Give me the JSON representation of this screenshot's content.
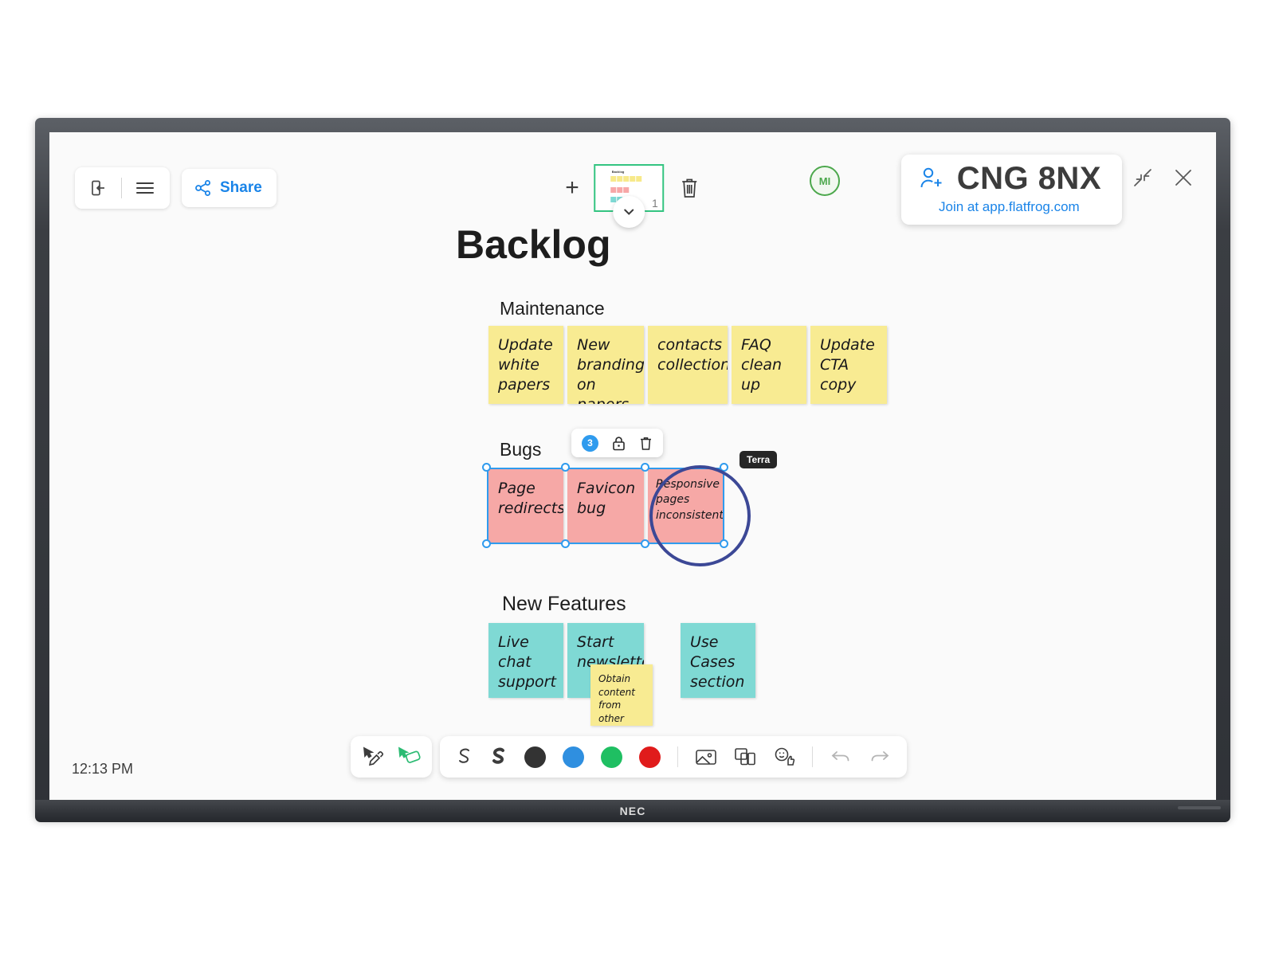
{
  "device": {
    "brand": "NEC"
  },
  "topbar": {
    "exit_icon": "exit-door-icon",
    "menu_icon": "hamburger-menu-icon",
    "share_label": "Share",
    "share_icon": "share-nodes-icon",
    "add_page_label": "+",
    "page_number": "1",
    "delete_page_icon": "trash-icon",
    "expand_pages_icon": "chevron-down-icon",
    "avatar_initials": "MI",
    "session_code": "CNG 8NX",
    "join_text": "Join at app.flatfrog.com",
    "invite_icon": "add-person-icon",
    "minimize_icon": "collapse-arrows-icon",
    "close_icon": "close-icon"
  },
  "board": {
    "title": "Backlog",
    "sections": [
      {
        "label": "Maintenance",
        "notes": [
          "Update white papers",
          "New branding on papers",
          "contacts collection",
          "FAQ clean up",
          "Update CTA copy"
        ]
      },
      {
        "label": "Bugs",
        "notes": [
          "Page redirects",
          "Favicon bug",
          "Responsive pages inconsistent"
        ]
      },
      {
        "label": "New Features",
        "notes": [
          "Live chat support",
          "Start newsletter",
          "Use Cases section"
        ],
        "extra_note": "Obtain content from other departments"
      }
    ]
  },
  "selection": {
    "count": "3",
    "lock_icon": "lock-icon",
    "delete_icon": "trash-icon",
    "user_tag": "Terra"
  },
  "toolbar": {
    "pen_icon": "pen-cursor-icon",
    "eraser_icon": "eraser-cursor-icon",
    "stroke_thin_icon": "stroke-thin-icon",
    "stroke_thick_icon": "stroke-thick-icon",
    "colors": [
      {
        "name": "black",
        "hex": "#333333"
      },
      {
        "name": "blue",
        "hex": "#2f8fe0"
      },
      {
        "name": "green",
        "hex": "#1fbf62"
      },
      {
        "name": "red",
        "hex": "#e01b1b"
      }
    ],
    "image_icon": "image-icon",
    "notes_icon": "sticky-notes-icon",
    "emoji_icon": "emoji-reaction-icon",
    "undo_icon": "undo-icon",
    "redo_icon": "redo-icon"
  },
  "statusbar": {
    "time": "12:13 PM"
  },
  "colors": {
    "accent_blue": "#1a84e8",
    "note_yellow": "#f8eb92",
    "note_red": "#f6a8a6",
    "note_teal": "#7fd9d4",
    "ink_navy": "#3c4896",
    "selection_blue": "#2f9bee",
    "page_green": "#33c481"
  }
}
